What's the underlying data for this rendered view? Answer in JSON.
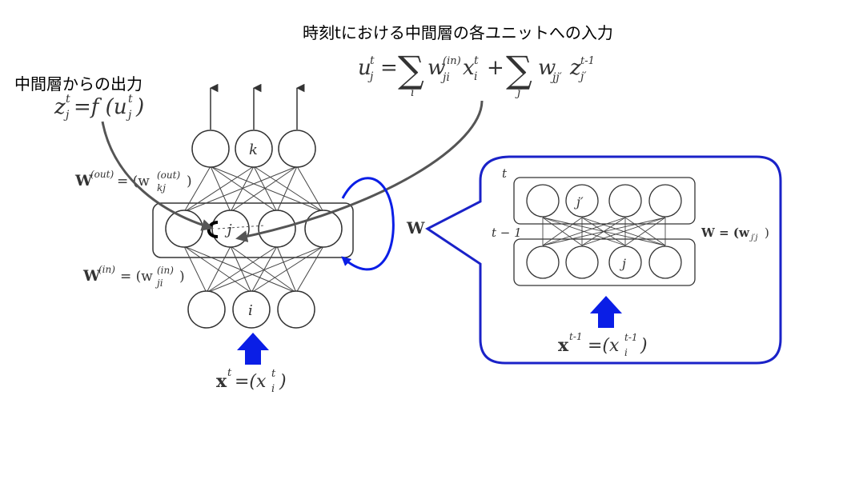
{
  "annotations": {
    "input_title": "時刻tにおける中間層の各ユニットへの入力",
    "output_title": "中間層からの出力"
  },
  "formulas": {
    "input_lhs": "u",
    "input_sup": "t",
    "input_sub": "j",
    "input_eq": "=",
    "sum_symbol": "∑",
    "sum1_index": "i",
    "term1_w": "w",
    "term1_sub": "ji",
    "term1_sup": "(in)",
    "term1_x": "x",
    "term1_x_sup": "t",
    "term1_x_sub": "i",
    "plus": "+",
    "sum2_index": "j′",
    "term2_w": "w",
    "term2_sub": "jj′",
    "term2_z": "z",
    "term2_z_sup": "t-1",
    "term2_z_sub": "j′",
    "output_lhs": "z",
    "output_sup": "t",
    "output_sub": "j",
    "output_rhs_f": "=f (u",
    "output_rhs_sup": "t",
    "output_rhs_sub": "j",
    "output_rhs_close": ")"
  },
  "network": {
    "output_node_label": "k",
    "hidden_node_label": "j",
    "input_node_label": "i",
    "w_out_W": "W",
    "w_out_sup": "(out)",
    "w_out_eq": "= (w",
    "w_out_sub": "kj",
    "w_out_sup2": "(out)",
    "w_out_close": ")",
    "w_in_W": "W",
    "w_in_sup": "(in)",
    "w_in_eq": "= (w",
    "w_in_sub": "ji",
    "w_in_sup2": "(in)",
    "w_in_close": ")",
    "x_bold": "x",
    "x_sup": "t",
    "x_eq": "=(x",
    "x_sup2": "t",
    "x_sub": "i",
    "x_close": ")"
  },
  "recurrent": {
    "label": "W"
  },
  "callout": {
    "t_label": "t",
    "t_minus_1_label": "t − 1",
    "node_j_prime": "j′",
    "node_j": "j",
    "w_eq": "W = (w",
    "w_sub": "j′j",
    "w_close": ")",
    "x_bold": "x",
    "x_sup": "t-1",
    "x_eq": "=(x",
    "x_sup2": "t-1",
    "x_sub": "i",
    "x_close": ")"
  },
  "colors": {
    "highlight_blue": "#0a1ee6",
    "callout_border": "#1a22c8",
    "ink": "#333333",
    "annotation_arrow": "#555555"
  }
}
